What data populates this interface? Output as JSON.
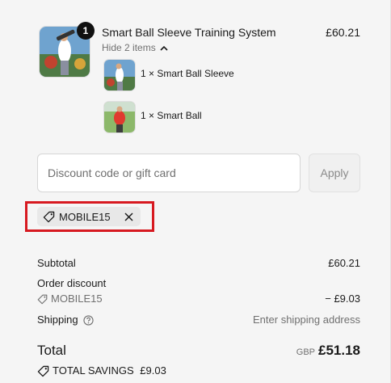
{
  "product": {
    "quantity": "1",
    "title": "Smart Ball Sleeve Training System",
    "price": "£60.21",
    "toggle_label": "Hide 2 items",
    "items": [
      {
        "label": "1 × Smart Ball Sleeve"
      },
      {
        "label": "1 × Smart Ball"
      }
    ]
  },
  "discount": {
    "placeholder": "Discount code or gift card",
    "apply_label": "Apply",
    "applied_code": "MOBILE15"
  },
  "summary": {
    "subtotal_label": "Subtotal",
    "subtotal_value": "£60.21",
    "order_discount_label": "Order discount",
    "order_discount_code": "MOBILE15",
    "order_discount_value": "− £9.03",
    "shipping_label": "Shipping",
    "shipping_value": "Enter shipping address",
    "total_label": "Total",
    "total_currency": "GBP",
    "total_value": "£51.18",
    "savings_label": "TOTAL SAVINGS",
    "savings_value": "£9.03"
  },
  "colors": {
    "highlight": "#d71920",
    "background": "#f5f5f5",
    "badge": "#111111"
  }
}
